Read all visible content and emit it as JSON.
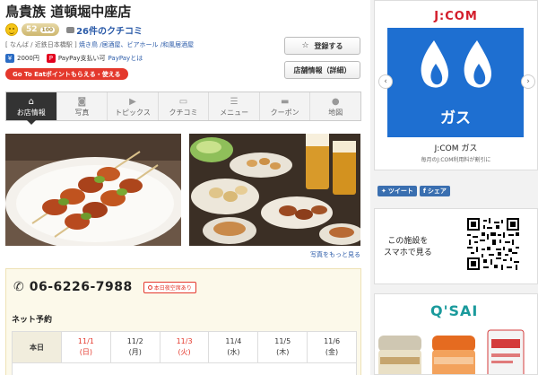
{
  "shop": {
    "name": "鳥貴族 道頓堀中座店",
    "score": "52",
    "score_max": "100",
    "reviews_link": "26件のクチコミ",
    "categories_prefix": "[ なんば / 近鉄日本橋駅 ]",
    "categories_links": "焼き鳥 /居酒屋、ビアホール /和風居酒屋",
    "price": "2000円",
    "payment_text": "PayPay支払い可",
    "payment_link": "PayPayとは",
    "goto_eat_label": "Go To Eatポイントもらえる・使える"
  },
  "actions": {
    "register_label": "登録する",
    "info_label": "店舗情報（詳細）"
  },
  "tabs": [
    {
      "label": "お店情報",
      "icon": "house-icon",
      "glyph": "⌂"
    },
    {
      "label": "写真",
      "icon": "camera-icon",
      "glyph": "◙"
    },
    {
      "label": "トピックス",
      "icon": "flag-icon",
      "glyph": "▶"
    },
    {
      "label": "クチコミ",
      "icon": "comment-icon",
      "glyph": "▭"
    },
    {
      "label": "メニュー",
      "icon": "list-icon",
      "glyph": "☰"
    },
    {
      "label": "クーポン",
      "icon": "ticket-icon",
      "glyph": "▬"
    },
    {
      "label": "地図",
      "icon": "map-pin-icon",
      "glyph": "●"
    }
  ],
  "photos": {
    "more_link": "写真をもっと見る"
  },
  "booking": {
    "phone": "06-6226-7988",
    "tonight_badge": "本日夜空席あり",
    "net_label": "ネット予約",
    "header": "本日",
    "days": [
      {
        "date": "11/1",
        "weekday": "(日)",
        "holiday": true
      },
      {
        "date": "11/2",
        "weekday": "(月)",
        "holiday": false
      },
      {
        "date": "11/3",
        "weekday": "(火)",
        "holiday": true
      },
      {
        "date": "11/4",
        "weekday": "(水)",
        "holiday": false
      },
      {
        "date": "11/5",
        "weekday": "(木)",
        "holiday": false
      },
      {
        "date": "11/6",
        "weekday": "(金)",
        "holiday": false
      }
    ]
  },
  "ads": {
    "jcom_logo": "J:COM",
    "gas_text": "ガス",
    "caption": "J:COM ガス",
    "sub": "毎月のJ:COM利用料が割引に",
    "share_tweet": "ツイート",
    "share_fb": "シェア",
    "qr_text_line1": "この施設を",
    "qr_text_line2": "スマホで見る",
    "qsai_logo": "Q'SAI"
  },
  "colors": {
    "accent_red": "#e4382c",
    "link_blue": "#2a5aa8",
    "jcom_blue": "#1e6fd1",
    "booking_bg": "#fcf9ea"
  }
}
